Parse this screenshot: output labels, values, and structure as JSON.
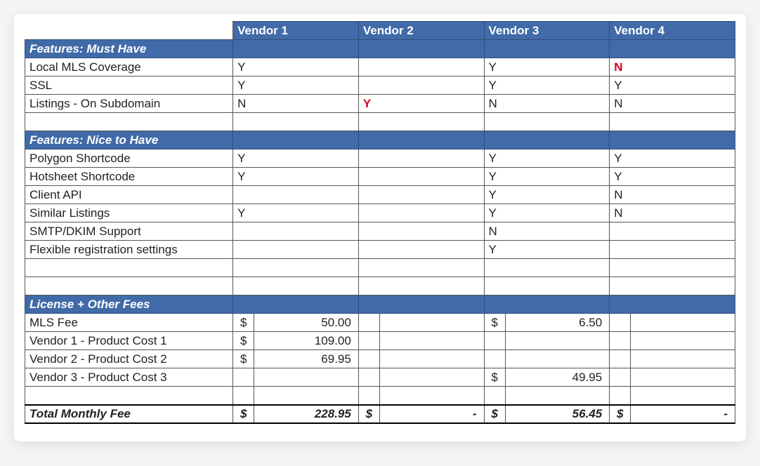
{
  "headers": {
    "blank": "",
    "v1": "Vendor 1",
    "v2": "Vendor 2",
    "v3": "Vendor 3",
    "v4": "Vendor 4"
  },
  "sections": {
    "must": "Features: Must Have",
    "nice": "Features: Nice to Have",
    "fees": "License + Other Fees"
  },
  "rows": {
    "mls": {
      "label": "Local MLS Coverage",
      "v1": "Y",
      "v2": "",
      "v3": "Y",
      "v4": "N",
      "v4_neg": true
    },
    "ssl": {
      "label": "SSL",
      "v1": "Y",
      "v2": "",
      "v3": "Y",
      "v4": "Y"
    },
    "sub": {
      "label": "Listings - On Subdomain",
      "v1": "N",
      "v2": "Y",
      "v2_neg": true,
      "v3": "N",
      "v4": "N"
    },
    "poly": {
      "label": "Polygon Shortcode",
      "v1": "Y",
      "v2": "",
      "v3": "Y",
      "v4": "Y"
    },
    "hot": {
      "label": "Hotsheet Shortcode",
      "v1": "Y",
      "v2": "",
      "v3": "Y",
      "v4": "Y"
    },
    "api": {
      "label": "Client API",
      "v1": "",
      "v2": "",
      "v3": "Y",
      "v4": "N"
    },
    "sim": {
      "label": "Similar Listings",
      "v1": "Y",
      "v2": "",
      "v3": "Y",
      "v4": "N"
    },
    "smtp": {
      "label": "SMTP/DKIM Support",
      "v1": "",
      "v2": "",
      "v3": "N",
      "v4": ""
    },
    "flex": {
      "label": "Flexible registration settings",
      "v1": "",
      "v2": "",
      "v3": "Y",
      "v4": ""
    },
    "mlsfee": {
      "label": "MLS Fee",
      "c1": "$",
      "v1": "50.00",
      "c3": "$",
      "v3": "6.50"
    },
    "p1": {
      "label": "Vendor 1 - Product Cost 1",
      "c1": "$",
      "v1": "109.00"
    },
    "p2": {
      "label": "Vendor 2 - Product Cost 2",
      "c1": "$",
      "v1": "69.95"
    },
    "p3": {
      "label": "Vendor 3 - Product Cost 3",
      "c3": "$",
      "v3": "49.95"
    }
  },
  "total": {
    "label": "Total Monthly Fee",
    "c1": "$",
    "v1": "228.95",
    "c2": "$",
    "v2": "-",
    "c3": "$",
    "v3": "56.45",
    "c4": "$",
    "v4": "-"
  }
}
